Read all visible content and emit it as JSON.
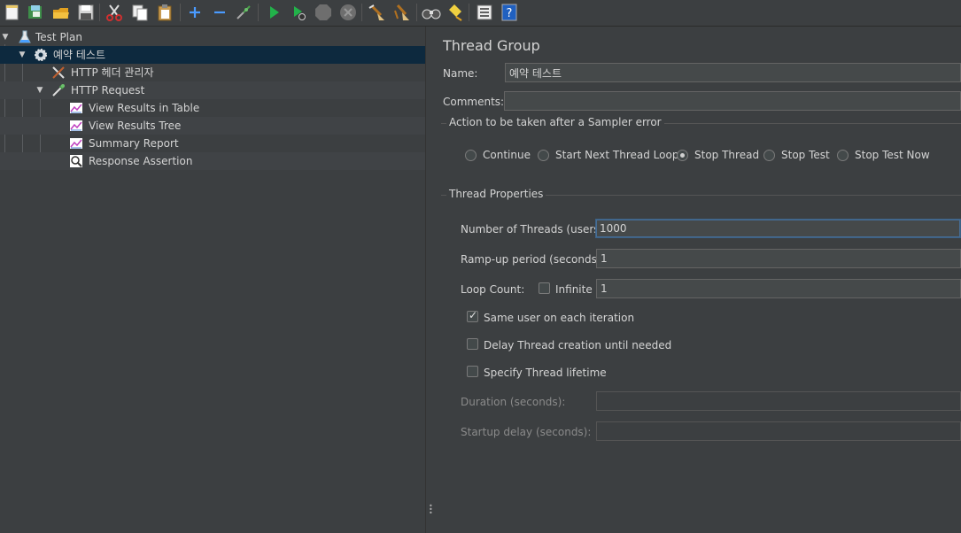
{
  "toolbar": {
    "buttons": [
      {
        "name": "new-icon"
      },
      {
        "name": "templates-icon"
      },
      {
        "name": "open-icon"
      },
      {
        "name": "save-icon"
      },
      {
        "name": "cut-icon"
      },
      {
        "name": "copy-icon"
      },
      {
        "name": "paste-icon"
      },
      {
        "name": "expand-icon"
      },
      {
        "name": "collapse-icon"
      },
      {
        "name": "toggle-icon"
      },
      {
        "name": "start-icon"
      },
      {
        "name": "start-no-pauses-icon"
      },
      {
        "name": "stop-icon"
      },
      {
        "name": "shutdown-icon"
      },
      {
        "name": "clear-icon"
      },
      {
        "name": "clear-all-icon"
      },
      {
        "name": "search-icon"
      },
      {
        "name": "reset-search-icon"
      },
      {
        "name": "function-helper-icon"
      },
      {
        "name": "help-icon"
      }
    ]
  },
  "tree": {
    "items": [
      {
        "label": "Test Plan",
        "icon": "flask-icon"
      },
      {
        "label": "예약 테스트",
        "icon": "gear-icon"
      },
      {
        "label": "HTTP 헤더 관리자",
        "icon": "tools-icon"
      },
      {
        "label": "HTTP Request",
        "icon": "pipette-icon"
      },
      {
        "label": "View Results in Table",
        "icon": "chart-icon"
      },
      {
        "label": "View Results Tree",
        "icon": "chart-icon"
      },
      {
        "label": "Summary Report",
        "icon": "chart-icon"
      },
      {
        "label": "Response Assertion",
        "icon": "magnifier-icon"
      }
    ]
  },
  "panel": {
    "title": "Thread Group",
    "name_label": "Name:",
    "name_value": "예약 테스트",
    "comments_label": "Comments:",
    "comments_value": "",
    "sampler_error": {
      "legend": "Action to be taken after a Sampler error",
      "options": [
        "Continue",
        "Start Next Thread Loop",
        "Stop Thread",
        "Stop Test",
        "Stop Test Now"
      ],
      "selected": "Stop Thread"
    },
    "thread_props": {
      "legend": "Thread Properties",
      "threads_label": "Number of Threads (users):",
      "threads_value": "1000",
      "rampup_label": "Ramp-up period (seconds):",
      "rampup_value": "1",
      "loop_label": "Loop Count:",
      "infinite_label": "Infinite",
      "infinite_checked": false,
      "loop_value": "1",
      "same_user_label": "Same user on each iteration",
      "same_user_checked": true,
      "delay_label": "Delay Thread creation until needed",
      "delay_checked": false,
      "lifetime_label": "Specify Thread lifetime",
      "lifetime_checked": false,
      "duration_label": "Duration (seconds):",
      "duration_value": "",
      "startup_label": "Startup delay (seconds):",
      "startup_value": ""
    }
  }
}
